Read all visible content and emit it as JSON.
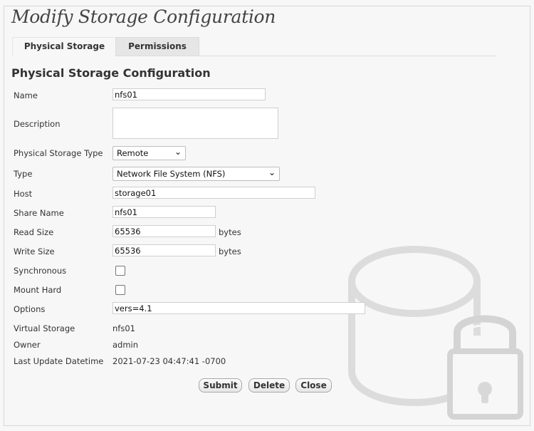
{
  "page_title": "Modify Storage Configuration",
  "tabs": [
    {
      "label": "Physical Storage"
    },
    {
      "label": "Permissions"
    }
  ],
  "section_title": "Physical Storage Configuration",
  "fields": {
    "name": {
      "label": "Name",
      "value": "nfs01"
    },
    "description": {
      "label": "Description",
      "value": ""
    },
    "physical_storage_type": {
      "label": "Physical Storage Type",
      "value": "Remote"
    },
    "type": {
      "label": "Type",
      "value": "Network File System (NFS)"
    },
    "host": {
      "label": "Host",
      "value": "storage01"
    },
    "share_name": {
      "label": "Share Name",
      "value": "nfs01"
    },
    "read_size": {
      "label": "Read Size",
      "value": "65536",
      "unit": "bytes"
    },
    "write_size": {
      "label": "Write Size",
      "value": "65536",
      "unit": "bytes"
    },
    "synchronous": {
      "label": "Synchronous",
      "checked": false
    },
    "mount_hard": {
      "label": "Mount Hard",
      "checked": false
    },
    "options": {
      "label": "Options",
      "value": "vers=4.1"
    },
    "virtual_storage": {
      "label": "Virtual Storage",
      "value": "nfs01"
    },
    "owner": {
      "label": "Owner",
      "value": "admin"
    },
    "last_update": {
      "label": "Last Update Datetime",
      "value": "2021-07-23 04:47:41 -0700"
    }
  },
  "buttons": {
    "submit": "Submit",
    "delete": "Delete",
    "close": "Close"
  },
  "icons": {
    "background": "storage-lock-icon",
    "select_arrow": "chevron-down-icon"
  }
}
